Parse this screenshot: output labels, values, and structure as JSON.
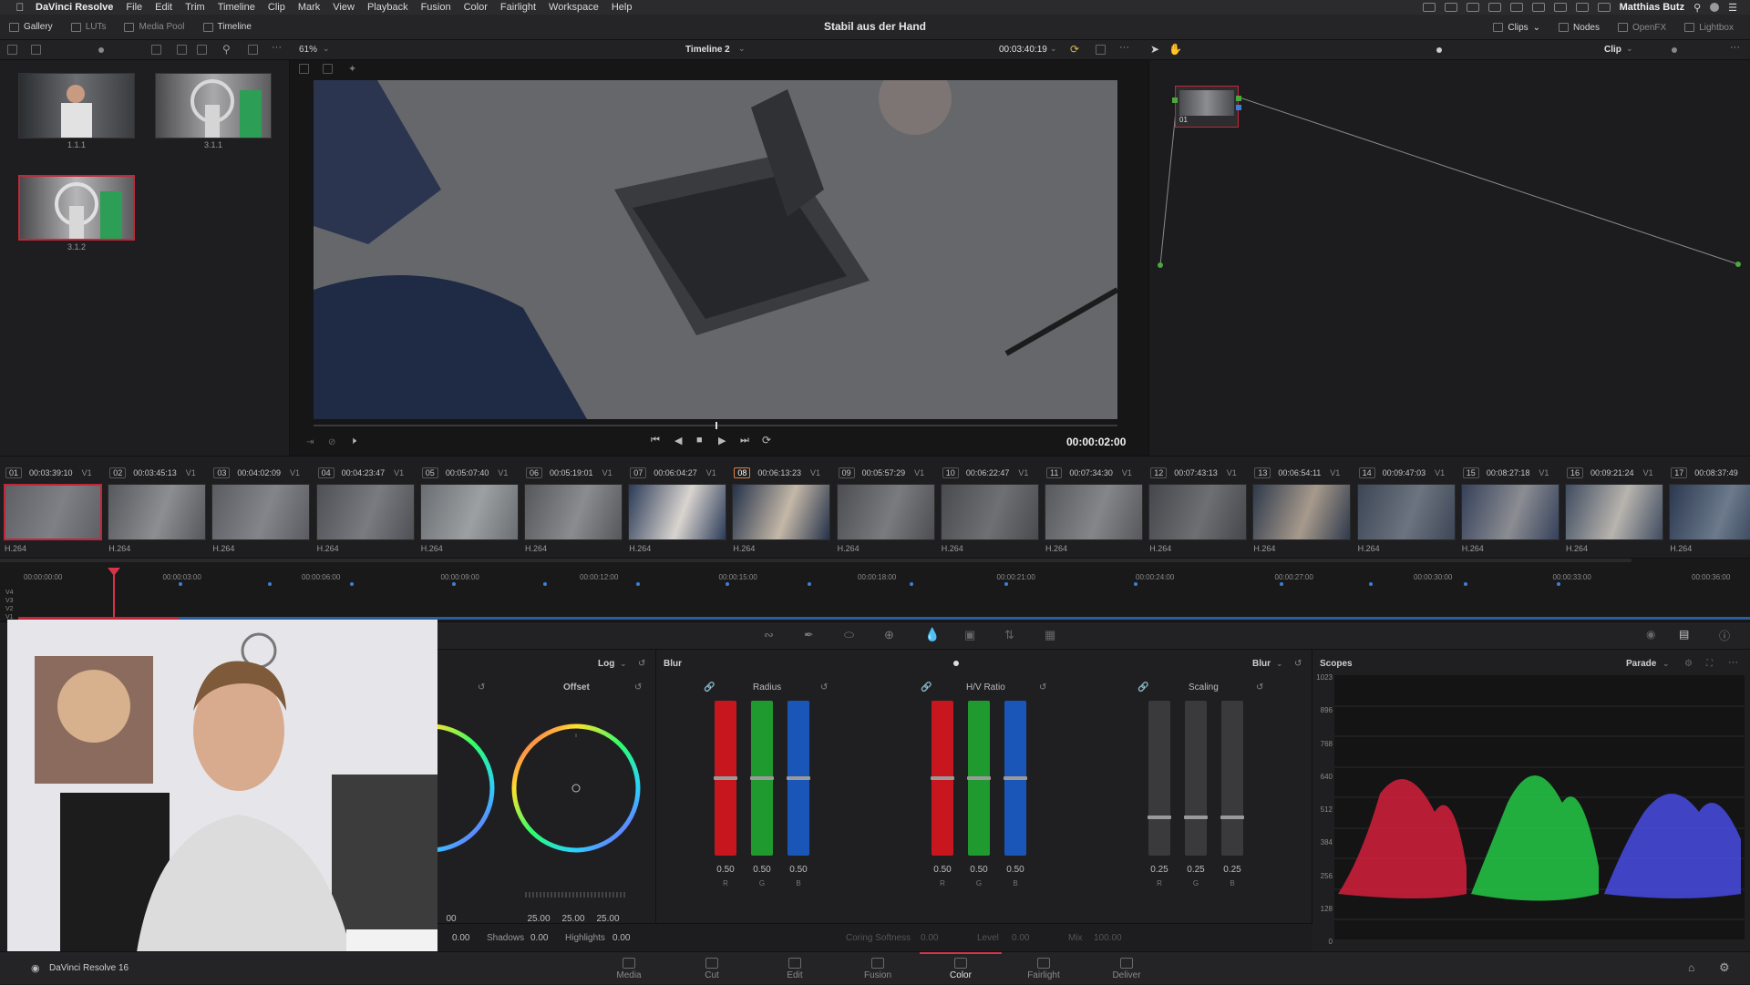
{
  "menubar": {
    "items": [
      "DaVinci Resolve",
      "File",
      "Edit",
      "Trim",
      "Timeline",
      "Clip",
      "Mark",
      "View",
      "Playback",
      "Fusion",
      "Color",
      "Fairlight",
      "Workspace",
      "Help"
    ],
    "user": "Matthias Butz"
  },
  "toolbar": {
    "gallery": "Gallery",
    "luts": "LUTs",
    "media_pool": "Media Pool",
    "timeline": "Timeline",
    "project_title": "Stabil aus der Hand",
    "clips": "Clips",
    "nodes": "Nodes",
    "openfx": "OpenFX",
    "lightbox": "Lightbox"
  },
  "viewer": {
    "zoom": "61%",
    "timeline_name": "Timeline 2",
    "source_tc": "00:03:40:19",
    "record_tc": "00:00:02:00",
    "clip_mode": "Clip",
    "progress": 0.5
  },
  "gallery": {
    "stills": [
      {
        "label": "1.1.1",
        "selected": false
      },
      {
        "label": "3.1.1",
        "selected": false
      },
      {
        "label": "3.1.2",
        "selected": true
      }
    ]
  },
  "nodes": {
    "node_label": "01"
  },
  "clips": [
    {
      "num": "01",
      "tc": "00:03:39:10",
      "track": "V1",
      "codec": "H.264",
      "selected": true
    },
    {
      "num": "02",
      "tc": "00:03:45:13",
      "track": "V1",
      "codec": "H.264",
      "selected": false
    },
    {
      "num": "03",
      "tc": "00:04:02:09",
      "track": "V1",
      "codec": "H.264",
      "selected": false
    },
    {
      "num": "04",
      "tc": "00:04:23:47",
      "track": "V1",
      "codec": "H.264",
      "selected": false
    },
    {
      "num": "05",
      "tc": "00:05:07:40",
      "track": "V1",
      "codec": "H.264",
      "selected": false
    },
    {
      "num": "06",
      "tc": "00:05:19:01",
      "track": "V1",
      "codec": "H.264",
      "selected": false
    },
    {
      "num": "07",
      "tc": "00:06:04:27",
      "track": "V1",
      "codec": "H.264",
      "selected": false
    },
    {
      "num": "08",
      "tc": "00:06:13:23",
      "track": "V1",
      "codec": "H.264",
      "selected": false
    },
    {
      "num": "09",
      "tc": "00:05:57:29",
      "track": "V1",
      "codec": "H.264",
      "selected": false
    },
    {
      "num": "10",
      "tc": "00:06:22:47",
      "track": "V1",
      "codec": "H.264",
      "selected": false
    },
    {
      "num": "11",
      "tc": "00:07:34:30",
      "track": "V1",
      "codec": "H.264",
      "selected": false
    },
    {
      "num": "12",
      "tc": "00:07:43:13",
      "track": "V1",
      "codec": "H.264",
      "selected": false
    },
    {
      "num": "13",
      "tc": "00:06:54:11",
      "track": "V1",
      "codec": "H.264",
      "selected": false
    },
    {
      "num": "14",
      "tc": "00:09:47:03",
      "track": "V1",
      "codec": "H.264",
      "selected": false
    },
    {
      "num": "15",
      "tc": "00:08:27:18",
      "track": "V1",
      "codec": "H.264",
      "selected": false
    },
    {
      "num": "16",
      "tc": "00:09:21:24",
      "track": "V1",
      "codec": "H.264",
      "selected": false
    },
    {
      "num": "17",
      "tc": "00:08:37:49",
      "track": "",
      "codec": "H.264",
      "selected": false
    }
  ],
  "mini_timeline": {
    "ticks": [
      "00:00:00:00",
      "00:00:03:00",
      "00:00:06:00",
      "00:00:09:00",
      "00:00:12:00",
      "00:00:15:00",
      "00:00:18:00",
      "00:00:21:00",
      "00:00:24:00",
      "00:00:27:00",
      "00:00:30:00",
      "00:00:33:00",
      "00:00:36:00"
    ],
    "tracks": [
      "V4",
      "V3",
      "V2",
      "V1"
    ]
  },
  "wheels": {
    "mode": "Log",
    "offset_label": "Offset",
    "offset_values": {
      "r": "25.00",
      "g": "25.00",
      "b": "25.00"
    },
    "partial_value": "00",
    "shadows_label": "Shadows",
    "shadows_value": "0.00",
    "highlights_label": "Highlights",
    "highlights_value": "0.00",
    "lead_value": "0.00"
  },
  "blur": {
    "title": "Blur",
    "mode": "Blur",
    "radius_label": "Radius",
    "radius": {
      "r": "0.50",
      "g": "0.50",
      "b": "0.50"
    },
    "radius_level": 0.5,
    "hv_label": "H/V Ratio",
    "hv": {
      "r": "0.50",
      "g": "0.50",
      "b": "0.50"
    },
    "hv_level": 0.5,
    "scaling_label": "Scaling",
    "scaling": {
      "r": "0.25",
      "g": "0.25",
      "b": "0.25"
    },
    "scaling_level": 0.25,
    "coring_label": "Coring Softness",
    "coring_value": "0.00",
    "level_label": "Level",
    "level_value": "0.00",
    "mix_label": "Mix",
    "mix_value": "100.00",
    "rgb": [
      "R",
      "G",
      "B"
    ]
  },
  "scopes": {
    "title": "Scopes",
    "mode": "Parade",
    "scale": [
      "1023",
      "896",
      "768",
      "640",
      "512",
      "384",
      "256",
      "128",
      "0"
    ]
  },
  "pages": [
    "Media",
    "Cut",
    "Edit",
    "Fusion",
    "Color",
    "Fairlight",
    "Deliver"
  ],
  "active_page": "Color",
  "footer": {
    "app_version": "DaVinci Resolve 16"
  },
  "colors": {
    "accent": "#d5344a",
    "selection": "#c0283a",
    "red": "#c8161e",
    "green": "#1f9a2e",
    "blue": "#1a56b8"
  }
}
